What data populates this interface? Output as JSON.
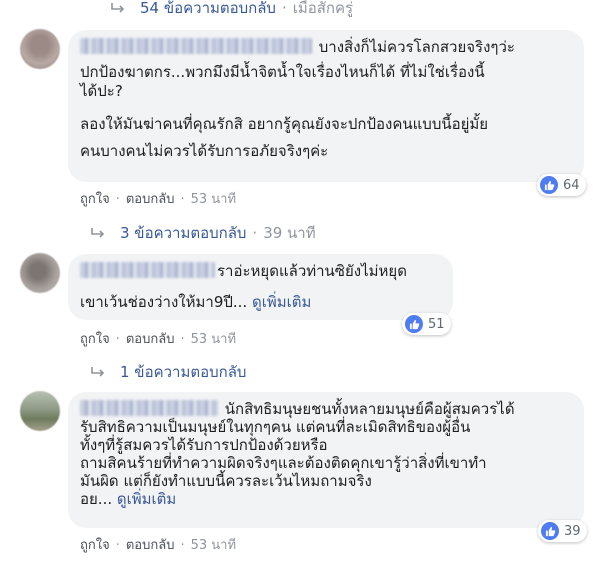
{
  "top_reply": {
    "count_text": "54 ข้อความตอบกลับ",
    "time_text": "เมื่อสักครู่"
  },
  "comments": [
    {
      "lines": [
        "บางสิ่งก็ไม่ควรโลกสวยจริงๆว่ะ",
        "ปกป้องฆาตกร...พวกมึงมีน้ำจิตน้ำใจเรื่องไหนก็ได้ ที่ไม่ใช่เรื่องนี้",
        "ได้ปะ?",
        "ลองให้มันฆ่าคนที่คุณรักสิ อยากรู้คุณยังจะปกป้องคนแบบนี้อยู่มั้ย",
        "คนบางคนไม่ควรได้รับการอภัยจริงๆค่ะ"
      ],
      "reaction_count": "64",
      "like_label": "ถูกใจ",
      "reply_label": "ตอบกลับ",
      "time": "53 นาที",
      "replies_count_text": "3 ข้อความตอบกลับ",
      "replies_time": "39 นาที"
    },
    {
      "lines": [
        "ราอ่ะหยุดแล้วท่านซิยังไม่หยุด",
        "เขาเว้นช่องว่างให้มา9ปี..."
      ],
      "see_more": "ดูเพิ่มเติม",
      "reaction_count": "51",
      "like_label": "ถูกใจ",
      "reply_label": "ตอบกลับ",
      "time": "53 นาที",
      "replies_count_text": "1 ข้อความตอบกลับ"
    },
    {
      "lines": [
        "นักสิทธิมนุษยชนทั้งหลายมนุษย์คือผู้สมควรได้",
        "รับสิทธิความเป็นมนุษย์ในทุกๆคน แต่คนที่ละเมิดสิทธิของผู้อื่น",
        "ทั้งๆที่รู้สมควรได้รับการปกป้องด้วยหรือ",
        "ถามสิคนร้ายที่ทำความผิดจริงๆและต้องติดคุกเขารู้ว่าสิ่งที่เขาทำ",
        "มันผิด แต่ก็ยังทำแบบนี้ควรละเว้นไหมถามจริง",
        "อย..."
      ],
      "see_more": "ดูเพิ่มเติม",
      "reaction_count": "39",
      "like_label": "ถูกใจ",
      "reply_label": "ตอบกลับ",
      "time": "53 นาที"
    }
  ],
  "colors": {
    "link": "#385898",
    "bubble_bg": "#f2f3f5",
    "like_blue": "#4f7cf1",
    "muted": "#90949c"
  }
}
